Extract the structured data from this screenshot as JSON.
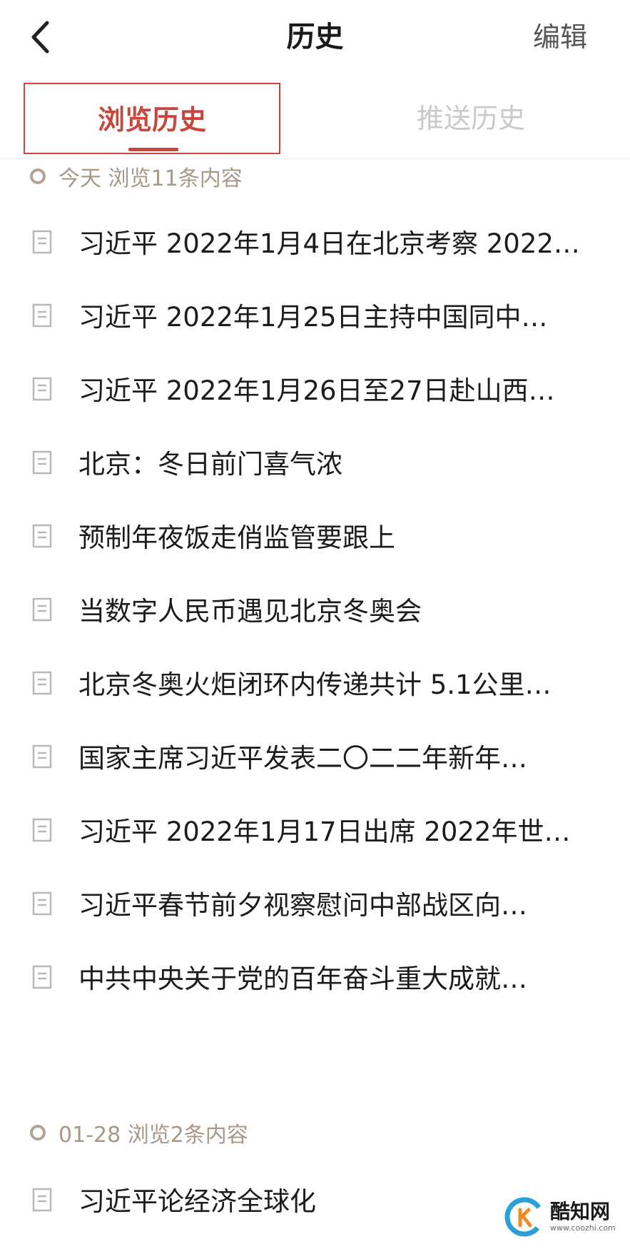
{
  "header": {
    "title": "历史",
    "edit_label": "编辑"
  },
  "tabs": [
    {
      "label": "浏览历史",
      "active": true
    },
    {
      "label": "推送历史",
      "active": false
    }
  ],
  "groups": [
    {
      "label": "今天 浏览11条内容",
      "items": [
        "习近平 2022年1月4日在北京考察 2022…",
        "习近平 2022年1月25日主持中国同中…",
        "习近平 2022年1月26日至27日赴山西…",
        "北京：冬日前门喜气浓",
        "预制年夜饭走俏监管要跟上",
        "当数字人民币遇见北京冬奥会",
        "北京冬奥火炬闭环内传递共计 5.1公里…",
        "国家主席习近平发表二〇二二年新年…",
        "习近平 2022年1月17日出席 2022年世…",
        "习近平春节前夕视察慰问中部战区向…",
        "中共中央关于党的百年奋斗重大成就…"
      ]
    },
    {
      "label": "01-28 浏览2条内容",
      "items": [
        "习近平论经济全球化"
      ]
    }
  ],
  "watermark": {
    "name": "酷知网",
    "url": "www.coozhi.com"
  },
  "colors": {
    "accent": "#c8473d",
    "group_label": "#a79888",
    "inactive_tab": "#c9c9c9"
  }
}
